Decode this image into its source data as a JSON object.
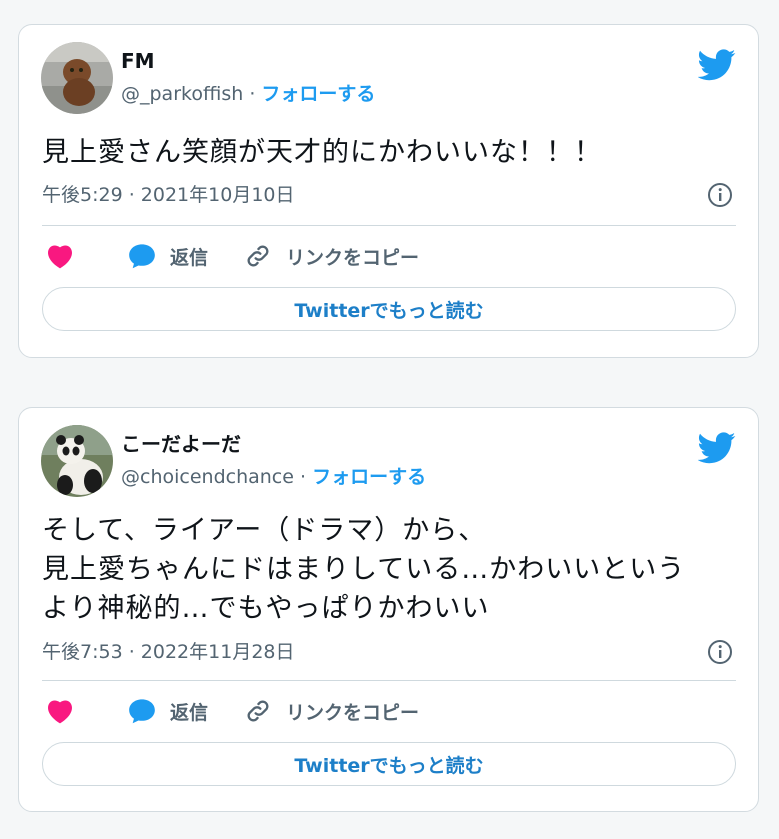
{
  "tweets": [
    {
      "name": "FM",
      "handle": "@_parkoffish",
      "separator": "·",
      "follow_label": "フォローする",
      "text": "見上愛さん笑顔が天才的にかわいいな！！！",
      "timestamp": "午後5:29 · 2021年10月10日",
      "like_icon": "heart-icon",
      "reply_label": "返信",
      "copy_label": "リンクをコピー",
      "read_more_label": "Twitterでもっと読む"
    },
    {
      "name": "こーだよーだ",
      "handle": "@choicendchance",
      "separator": "·",
      "follow_label": "フォローする",
      "text": "そして、ライアー（ドラマ）から、\n見上愛ちゃんにドはまりしている…かわいいという\nより神秘的…でもやっぱりかわいい",
      "timestamp": "午後7:53 · 2022年11月28日",
      "like_icon": "heart-icon",
      "reply_label": "返信",
      "copy_label": "リンクをコピー",
      "read_more_label": "Twitterでもっと読む"
    }
  ],
  "colors": {
    "accent": "#1d9bf0",
    "like": "#f91880",
    "muted": "#536471",
    "border": "#cfd9de"
  }
}
